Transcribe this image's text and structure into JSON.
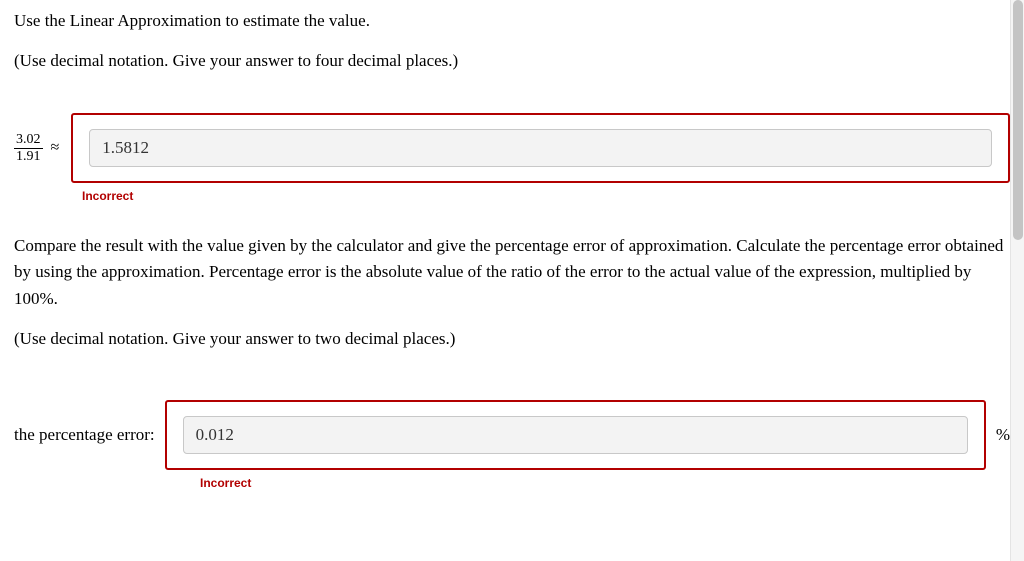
{
  "q1": {
    "line1": "Use the Linear Approximation to estimate the value.",
    "line2": "(Use decimal notation. Give your answer to four decimal places.)",
    "fraction_num": "3.02",
    "fraction_den": "1.91",
    "approx_symbol": "≈",
    "input_value": "1.5812",
    "feedback": "Incorrect"
  },
  "q2": {
    "paragraph": "Compare the result with the value given by the calculator and give the percentage error of approximation. Calculate the percentage error obtained by using the approximation. Percentage error is the absolute value of the ratio of the error to the actual value of the expression, multiplied by 100%.",
    "line2": "(Use decimal notation. Give your answer to two decimal places.)",
    "label": "the percentage error:",
    "input_value": "0.012",
    "unit": "%",
    "feedback": "Incorrect"
  }
}
